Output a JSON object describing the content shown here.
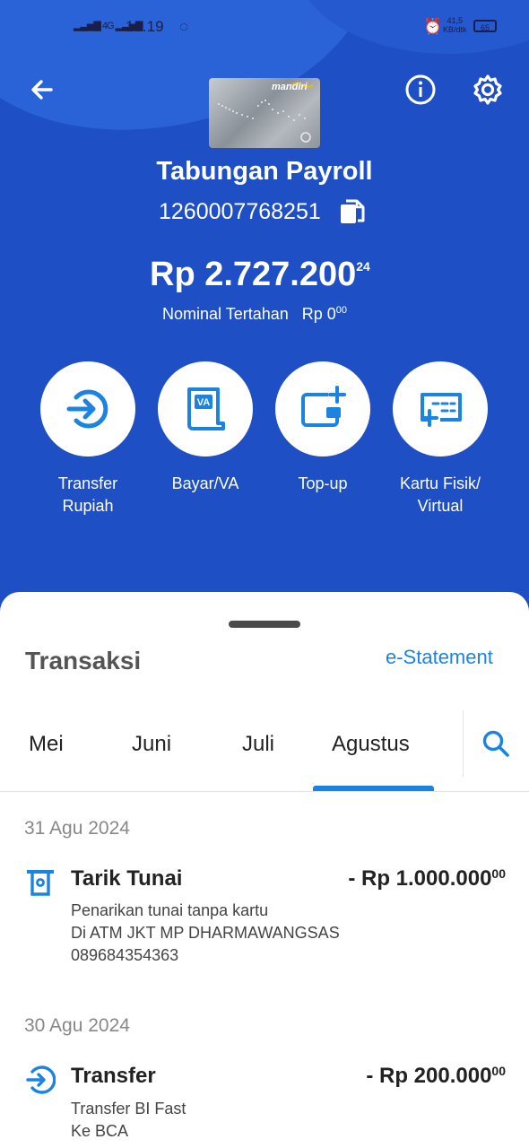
{
  "status_bar": {
    "signal": "4G",
    "time": "10.19",
    "speed": "41,5\nKB/dtk",
    "battery": "65"
  },
  "account": {
    "card_brand": "mandiri",
    "name": "Tabungan Payroll",
    "number": "1260007768251",
    "balance_main": "Rp 2.727.200",
    "balance_cents": "24",
    "held_label": "Nominal Tertahan",
    "held_value": "Rp 0",
    "held_cents": "00"
  },
  "actions": [
    {
      "label": "Transfer\nRupiah",
      "icon": "transfer-in-icon"
    },
    {
      "label": "Bayar/VA",
      "icon": "va-icon",
      "icon_text": "VA"
    },
    {
      "label": "Top-up",
      "icon": "wallet-plus-icon"
    },
    {
      "label": "Kartu Fisik/\nVirtual",
      "icon": "card-plus-icon"
    }
  ],
  "transactions": {
    "title": "Transaksi",
    "estatement": "e-Statement",
    "tabs": [
      "Mei",
      "Juni",
      "Juli",
      "Agustus"
    ],
    "active_tab": "Agustus",
    "groups": [
      {
        "date": "31 Agu 2024",
        "items": [
          {
            "name": "Tarik Tunai",
            "amount": "- Rp 1.000.000",
            "cents": "00",
            "desc": [
              "Penarikan tunai tanpa kartu",
              "Di ATM JKT MP DHARMAWANGSAS",
              "089684354363"
            ]
          }
        ]
      },
      {
        "date": "30 Agu 2024",
        "items": [
          {
            "name": "Transfer",
            "amount": "- Rp 200.000",
            "cents": "00",
            "desc": [
              "Transfer BI Fast",
              "Ke BCA"
            ]
          }
        ]
      }
    ]
  },
  "colors": {
    "primary": "#1f4fc4",
    "accent": "#1b84e0"
  }
}
